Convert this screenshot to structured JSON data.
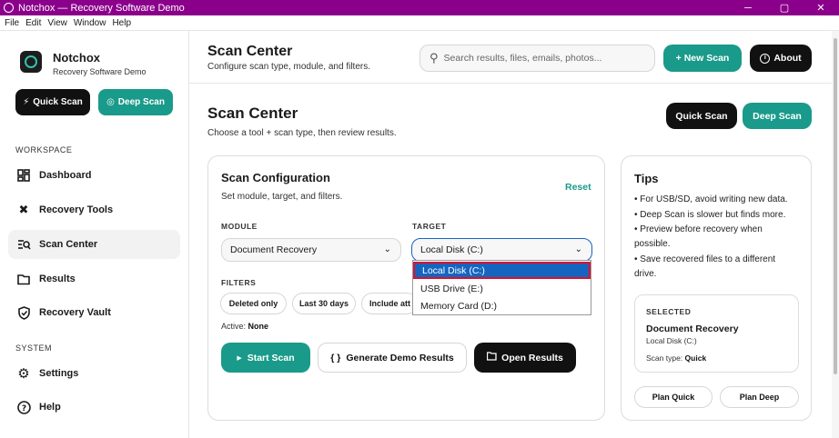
{
  "window": {
    "title": "Notchox — Recovery Software Demo",
    "controls": [
      "─",
      "▢",
      "✕"
    ]
  },
  "menu": [
    "File",
    "Edit",
    "View",
    "Window",
    "Help"
  ],
  "sidebar": {
    "brand_name": "Notchox",
    "brand_sub": "Recovery Software Demo",
    "quick_scan": "Quick Scan",
    "deep_scan": "Deep Scan",
    "workspace_label": "WORKSPACE",
    "items": [
      {
        "label": "Dashboard",
        "icon": "grid-icon"
      },
      {
        "label": "Recovery Tools",
        "icon": "tools-icon"
      },
      {
        "label": "Scan Center",
        "icon": "scan-icon"
      },
      {
        "label": "Results",
        "icon": "folder-icon"
      },
      {
        "label": "Recovery Vault",
        "icon": "shield-icon"
      }
    ],
    "system_label": "SYSTEM",
    "system_items": [
      {
        "label": "Settings",
        "icon": "gear-icon"
      },
      {
        "label": "Help",
        "icon": "help-icon"
      }
    ]
  },
  "header": {
    "title": "Scan Center",
    "subtitle": "Configure scan type, module, and filters.",
    "search_placeholder": "Search results, files, emails, photos...",
    "new_scan": "+ New Scan",
    "about": "About"
  },
  "page": {
    "title": "Scan Center",
    "subtitle": "Choose a tool + scan type, then review results.",
    "quick_scan": "Quick Scan",
    "deep_scan": "Deep Scan"
  },
  "config": {
    "title": "Scan Configuration",
    "subtitle": "Set module, target, and filters.",
    "reset": "Reset",
    "module_label": "MODULE",
    "module_value": "Document Recovery",
    "target_label": "TARGET",
    "target_value": "Local Disk (C:)",
    "target_options": [
      "Local Disk (C:)",
      "USB Drive (E:)",
      "Memory Card (D:)"
    ],
    "filters_label": "FILTERS",
    "chips": [
      "Deleted only",
      "Last 30 days",
      "Include att"
    ],
    "active_prefix": "Active:",
    "active_value": "None",
    "start_scan": "Start Scan",
    "generate": "Generate Demo Results",
    "open_results": "Open Results"
  },
  "tips": {
    "title": "Tips",
    "lines": [
      "• For USB/SD, avoid writing new data.",
      "• Deep Scan is slower but finds more.",
      "• Preview before recovery when",
      "possible.",
      "• Save recovered files to a different",
      "drive."
    ],
    "selected_label": "SELECTED",
    "selected_module": "Document Recovery",
    "selected_target": "Local Disk (C:)",
    "scan_type_prefix": "Scan type:",
    "scan_type_value": "Quick",
    "plan_quick": "Plan Quick",
    "plan_deep": "Plan Deep"
  }
}
